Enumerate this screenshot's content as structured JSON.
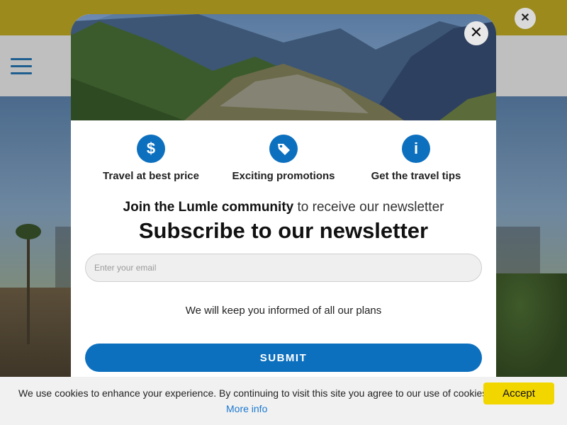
{
  "site": {
    "topbar_close_icon": "close-icon",
    "menu_icon": "hamburger-menu-icon"
  },
  "modal": {
    "close_label": "✕",
    "features": [
      {
        "icon": "dollar-icon",
        "glyph": "$",
        "label": "Travel at best price"
      },
      {
        "icon": "tag-icon",
        "glyph": "",
        "label": "Exciting promotions"
      },
      {
        "icon": "info-icon",
        "glyph": "i",
        "label": "Get the travel tips"
      }
    ],
    "tagline_bold": "Join the Lumle community",
    "tagline_rest": " to receive our newsletter",
    "headline": "Subscribe to our newsletter",
    "email_placeholder": "Enter your email",
    "info_text": "We will keep you informed of all our plans",
    "submit_label": "SUBMIT"
  },
  "cookie": {
    "message": "We use cookies to enhance your experience. By continuing to visit this site you agree to our use of cookies.",
    "more_info": "More info",
    "accept_label": "Accept"
  },
  "colors": {
    "accent": "#0d70bf",
    "topbar": "#9c8a1c",
    "accept": "#f2d600",
    "link": "#1b79d1"
  }
}
